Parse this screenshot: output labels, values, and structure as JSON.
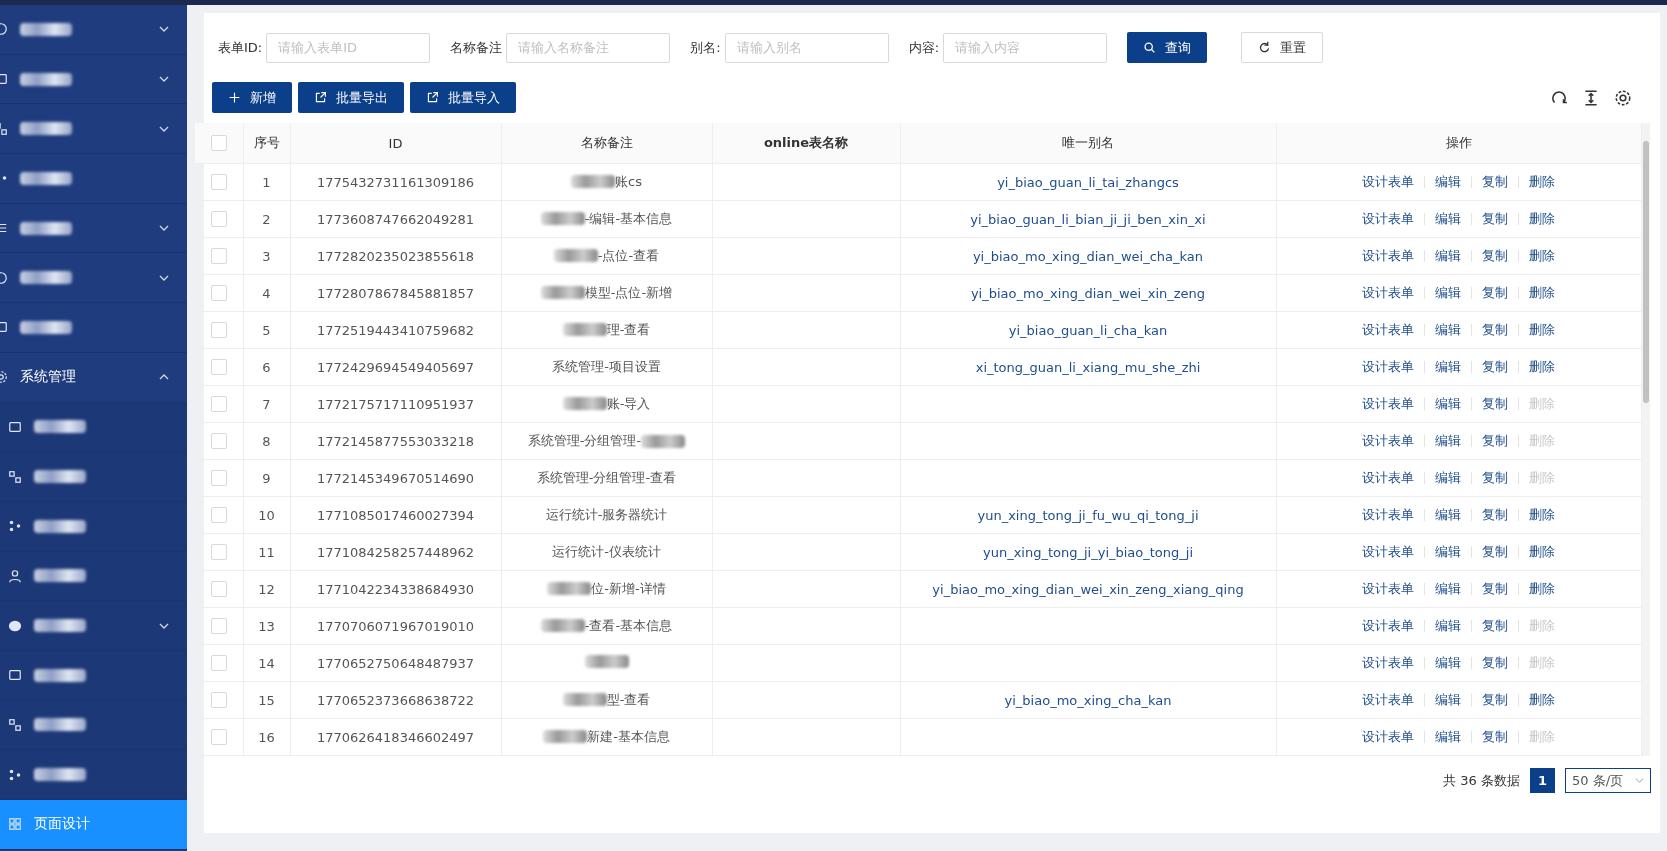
{
  "sidebar": {
    "items": [
      {
        "kind": "group",
        "expanded": false
      },
      {
        "kind": "group",
        "expanded": false
      },
      {
        "kind": "group",
        "expanded": false
      },
      {
        "kind": "link"
      },
      {
        "kind": "group",
        "expanded": false
      },
      {
        "kind": "group",
        "expanded": false
      },
      {
        "kind": "link"
      },
      {
        "label": "系统管理",
        "kind": "group",
        "expanded": true,
        "children": [
          {
            "kind": "link",
            "selected": false
          },
          {
            "kind": "link",
            "selected": false
          },
          {
            "kind": "link",
            "selected": false
          },
          {
            "kind": "link",
            "selected": false
          },
          {
            "kind": "group",
            "expanded": false,
            "selected": false
          },
          {
            "kind": "link",
            "selected": false
          },
          {
            "kind": "link",
            "selected": false
          },
          {
            "kind": "link",
            "selected": false
          },
          {
            "label": "页面设计",
            "kind": "link",
            "selected": true
          }
        ]
      }
    ]
  },
  "filters": [
    {
      "label": "表单ID:",
      "placeholder": "请输入表单ID"
    },
    {
      "label": "名称备注",
      "placeholder": "请输入名称备注"
    },
    {
      "label": "别名:",
      "placeholder": "请输入别名"
    },
    {
      "label": "内容:",
      "placeholder": "请输入内容"
    }
  ],
  "search_button": "查询",
  "reset_button": "重置",
  "actions": [
    "新增",
    "批量导出",
    "批量导入"
  ],
  "table": {
    "select_all_checked": false,
    "columns": [
      "序号",
      "ID",
      "名称备注",
      "online表名称",
      "唯一别名",
      "操作"
    ],
    "rows": [
      {
        "checked": false,
        "no": "1",
        "id": "1775432731161309186",
        "name": "账cs",
        "name_blurred": true,
        "alias": "yi_biao_guan_li_tai_zhangcs",
        "ops": [
          "设计表单",
          "编辑",
          "复制",
          "删除"
        ],
        "delete_disabled": false
      },
      {
        "checked": false,
        "no": "2",
        "id": "1773608747662049281",
        "name": "-编辑-基本信息",
        "name_blurred": true,
        "alias": "yi_biao_guan_li_bian_ji_ji_ben_xin_xi",
        "ops": [
          "设计表单",
          "编辑",
          "复制",
          "删除"
        ],
        "delete_disabled": false
      },
      {
        "checked": false,
        "no": "3",
        "id": "1772820235023855618",
        "name": "-点位-查看",
        "name_blurred": true,
        "alias": "yi_biao_mo_xing_dian_wei_cha_kan",
        "ops": [
          "设计表单",
          "编辑",
          "复制",
          "删除"
        ],
        "delete_disabled": false
      },
      {
        "checked": false,
        "no": "4",
        "id": "1772807867845881857",
        "name": "模型-点位-新增",
        "name_blurred": true,
        "alias": "yi_biao_mo_xing_dian_wei_xin_zeng",
        "ops": [
          "设计表单",
          "编辑",
          "复制",
          "删除"
        ],
        "delete_disabled": false
      },
      {
        "checked": false,
        "no": "5",
        "id": "1772519443410759682",
        "name": "理-查看",
        "name_blurred": true,
        "alias": "yi_biao_guan_li_cha_kan",
        "ops": [
          "设计表单",
          "编辑",
          "复制",
          "删除"
        ],
        "delete_disabled": false
      },
      {
        "checked": false,
        "no": "6",
        "id": "1772429694549405697",
        "name": "系统管理-项目设置",
        "name_blurred": false,
        "alias": "xi_tong_guan_li_xiang_mu_she_zhi",
        "ops": [
          "设计表单",
          "编辑",
          "复制",
          "删除"
        ],
        "delete_disabled": false
      },
      {
        "checked": false,
        "no": "7",
        "id": "1772175717110951937",
        "name": "账-导入",
        "name_blurred": true,
        "ops": [
          "设计表单",
          "编辑",
          "复制",
          "删除"
        ],
        "delete_disabled": true
      },
      {
        "checked": false,
        "no": "8",
        "id": "1772145877553033218",
        "name": "系统管理-分组管理-",
        "name_blurred": true,
        "name_blur_after": true,
        "ops": [
          "设计表单",
          "编辑",
          "复制",
          "删除"
        ],
        "delete_disabled": true
      },
      {
        "checked": false,
        "no": "9",
        "id": "1772145349670514690",
        "name": "系统管理-分组管理-查看",
        "name_blurred": false,
        "ops": [
          "设计表单",
          "编辑",
          "复制",
          "删除"
        ],
        "delete_disabled": true
      },
      {
        "checked": false,
        "no": "10",
        "id": "1771085017460027394",
        "name": "运行统计-服务器统计",
        "name_blurred": false,
        "alias": "yun_xing_tong_ji_fu_wu_qi_tong_ji",
        "ops": [
          "设计表单",
          "编辑",
          "复制",
          "删除"
        ],
        "delete_disabled": false
      },
      {
        "checked": false,
        "no": "11",
        "id": "1771084258257448962",
        "name": "运行统计-仪表统计",
        "name_blurred": false,
        "alias": "yun_xing_tong_ji_yi_biao_tong_ji",
        "ops": [
          "设计表单",
          "编辑",
          "复制",
          "删除"
        ],
        "delete_disabled": false
      },
      {
        "checked": false,
        "no": "12",
        "id": "1771042234338684930",
        "name": "位-新增-详情",
        "name_blurred": true,
        "alias": "yi_biao_mo_xing_dian_wei_xin_zeng_xiang_qing",
        "ops": [
          "设计表单",
          "编辑",
          "复制",
          "删除"
        ],
        "delete_disabled": false
      },
      {
        "checked": false,
        "no": "13",
        "id": "1770706071967019010",
        "name": "-查看-基本信息",
        "name_blurred": true,
        "ops": [
          "设计表单",
          "编辑",
          "复制",
          "删除"
        ],
        "delete_disabled": true
      },
      {
        "checked": false,
        "no": "14",
        "id": "1770652750648487937",
        "name_blurred": true,
        "ops": [
          "设计表单",
          "编辑",
          "复制",
          "删除"
        ],
        "delete_disabled": true
      },
      {
        "checked": false,
        "no": "15",
        "id": "1770652373668638722",
        "name": "型-查看",
        "name_blurred": true,
        "alias": "yi_biao_mo_xing_cha_kan",
        "ops": [
          "设计表单",
          "编辑",
          "复制",
          "删除"
        ],
        "delete_disabled": false
      },
      {
        "checked": false,
        "no": "16",
        "id": "1770626418346602497",
        "name": "新建-基本信息",
        "name_blurred": true,
        "ops": [
          "设计表单",
          "编辑",
          "复制",
          "删除"
        ],
        "delete_disabled": true
      }
    ]
  },
  "pagination": {
    "total": "共 36 条数据",
    "pages": [
      {
        "label": "1",
        "selected": true
      }
    ],
    "page_size": "50 条/页"
  }
}
